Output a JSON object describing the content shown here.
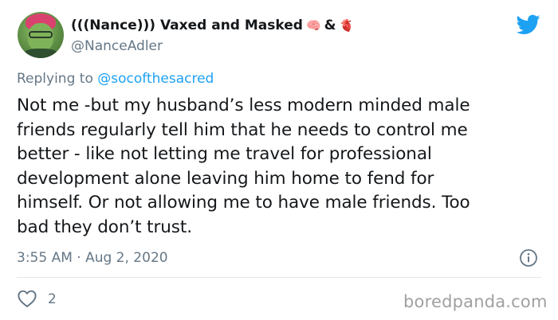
{
  "author": {
    "display_name": "(((Nance))) Vaxed and Masked",
    "emoji_1": "🧠",
    "separator": "&",
    "emoji_2": "🫀",
    "handle": "@NanceAdler"
  },
  "reply": {
    "prefix": "Replying to",
    "mention": "@socofthesacred"
  },
  "tweet": {
    "text_lines": [
      "Not me -but my husband’s less modern minded male",
      "friends regularly tell him that he needs to control me",
      "better - like not letting me travel for professional",
      "development alone leaving him home to fend for",
      "himself.  Or not allowing me to have male friends. Too",
      "bad they don’t trust."
    ],
    "timestamp": "3:55 AM · Aug 2, 2020",
    "like_count": "2"
  },
  "icons": {
    "brand": "twitter-bird-icon",
    "info": "info-icon",
    "like": "heart-icon"
  },
  "colors": {
    "brand_blue": "#1da1f2",
    "secondary_text": "#657786",
    "primary_text": "#14171a"
  },
  "watermark": "boredpanda.com"
}
